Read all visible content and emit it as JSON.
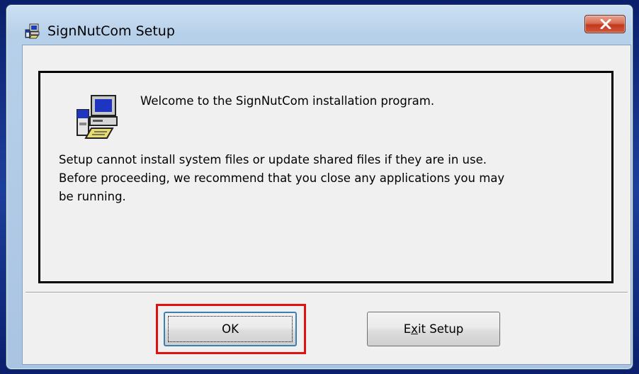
{
  "window": {
    "title": "SignNutCom Setup",
    "close_label": "Close"
  },
  "content": {
    "welcome": "Welcome to the SignNutCom installation program.",
    "body_lines": [
      "Setup cannot install system files or update shared files if they are in use.",
      "Before proceeding, we recommend that you close any applications you may",
      "be running."
    ]
  },
  "buttons": {
    "ok_label": "OK",
    "exit_label_pre": "E",
    "exit_label_mnemonic": "x",
    "exit_label_post": "it Setup"
  },
  "icons": {
    "title": "setup-computer-icon",
    "close": "close-icon",
    "content": "setup-computer-icon"
  },
  "colors": {
    "highlight": "#e01010",
    "close_button": "#c2391c"
  }
}
